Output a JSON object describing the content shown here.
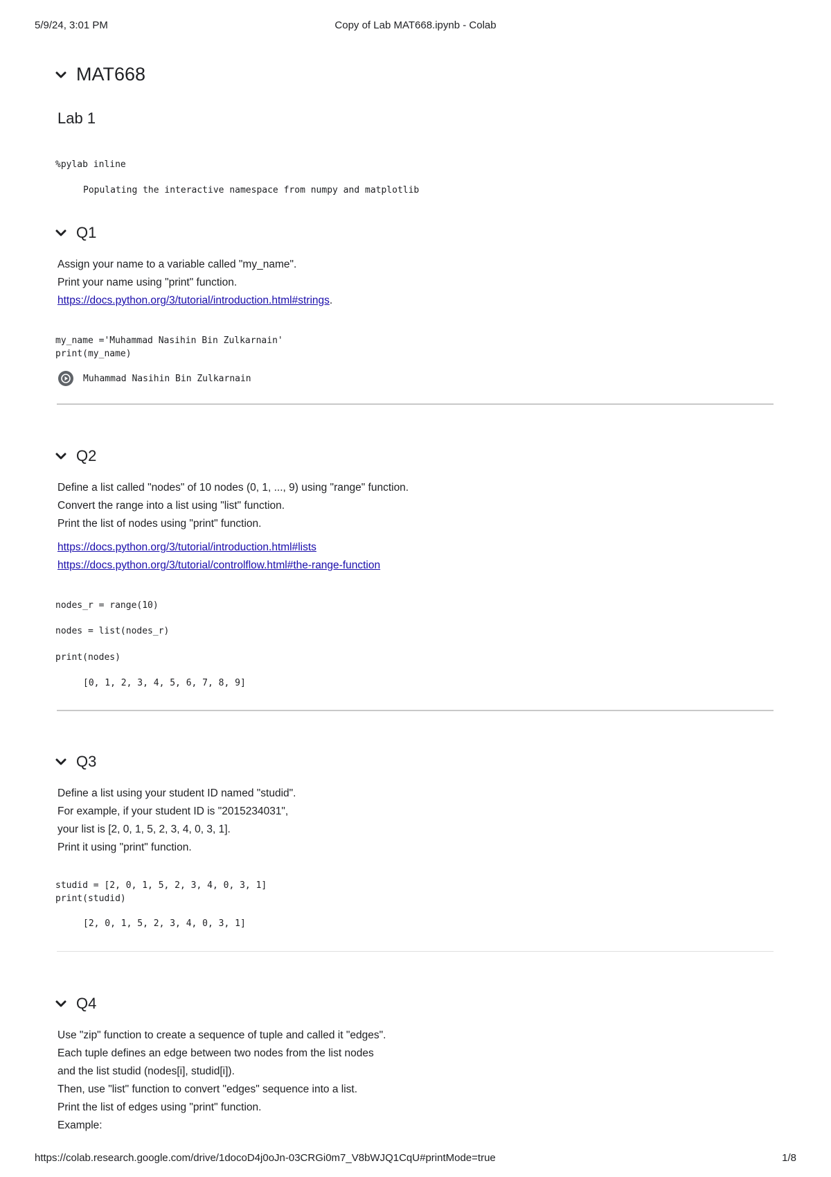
{
  "print_header": {
    "datetime": "5/9/24, 3:01 PM",
    "title": "Copy of Lab MAT668.ipynb - Colab"
  },
  "print_footer": {
    "url": "https://colab.research.google.com/drive/1docoD4j0oJn-03CRGi0m7_V8bWJQ1CqU#printMode=true",
    "page": "1/8"
  },
  "notebook": {
    "title": "MAT668",
    "lab_heading": "Lab 1",
    "pylab_code": "%pylab inline",
    "pylab_output": "Populating the interactive namespace from numpy and matplotlib"
  },
  "q1": {
    "heading": "Q1",
    "lines": [
      "Assign your name to a variable called \"my_name\".",
      "Print your name using \"print\" function."
    ],
    "link": "https://docs.python.org/3/tutorial/introduction.html#strings",
    "link_suffix": ".",
    "code": "my_name ='Muhammad Nasihin Bin Zulkarnain'\nprint(my_name)",
    "output": "Muhammad Nasihin Bin Zulkarnain"
  },
  "q2": {
    "heading": "Q2",
    "lines": [
      "Define a list called \"nodes\" of 10 nodes (0, 1, ..., 9) using \"range\" function.",
      "Convert the range into a list using \"list\" function.",
      "Print the list of nodes using \"print\" function."
    ],
    "links": [
      "https://docs.python.org/3/tutorial/introduction.html#lists",
      "https://docs.python.org/3/tutorial/controlflow.html#the-range-function"
    ],
    "code_1": "nodes_r = range(10)",
    "code_2": "nodes = list(nodes_r)",
    "code_3": "print(nodes)",
    "output": "[0, 1, 2, 3, 4, 5, 6, 7, 8, 9]"
  },
  "q3": {
    "heading": "Q3",
    "lines": [
      "Define a list using your student ID named \"studid\".",
      "For example, if your student ID is \"2015234031\",",
      "your list is [2, 0, 1, 5, 2, 3, 4, 0, 3, 1].",
      "Print it using \"print\" function."
    ],
    "code": "studid = [2, 0, 1, 5, 2, 3, 4, 0, 3, 1]\nprint(studid)",
    "output": "[2, 0, 1, 5, 2, 3, 4, 0, 3, 1]"
  },
  "q4": {
    "heading": "Q4",
    "lines": [
      "Use \"zip\" function to create a sequence of tuple and called it \"edges\".",
      "Each tuple defines an edge between two nodes from the list nodes",
      "and the list studid (nodes[i], studid[i]).",
      "Then, use \"list\" function to convert \"edges\" sequence into a list.",
      "Print the list of edges using \"print\" function.",
      "Example:"
    ]
  }
}
